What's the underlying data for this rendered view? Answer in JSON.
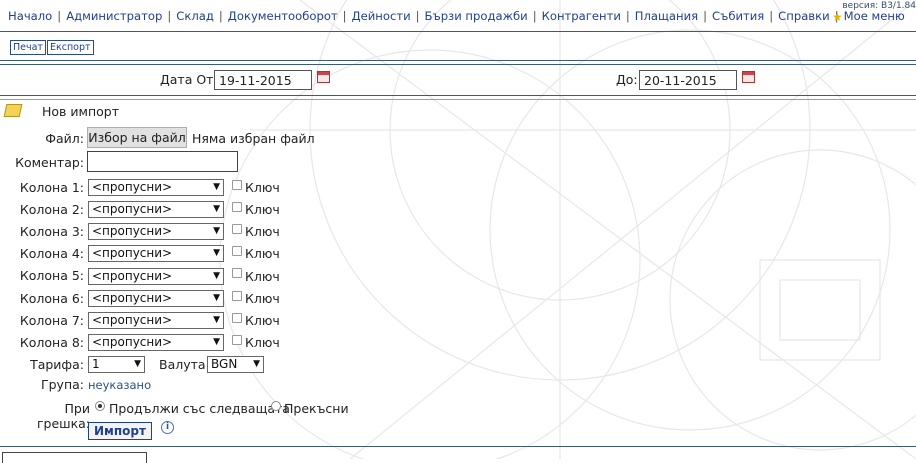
{
  "version": "версия: В3/1.84",
  "menu": [
    {
      "label": "Начало"
    },
    {
      "label": "Администратор"
    },
    {
      "label": "Склад"
    },
    {
      "label": "Документооборот"
    },
    {
      "label": "Дейности"
    },
    {
      "label": "Бързи продажби"
    },
    {
      "label": "Контрагенти"
    },
    {
      "label": "Плащания"
    },
    {
      "label": "Събития"
    },
    {
      "label": "Справки"
    },
    {
      "label": "Мое меню"
    }
  ],
  "toolbar": {
    "print_label": "Печат",
    "export_label": "Експорт"
  },
  "date_filter": {
    "from_label": "Дата От:",
    "from_value": "19-11-2015",
    "to_label": "До:",
    "to_value": "20-11-2015"
  },
  "import_form": {
    "title": "Нов импорт",
    "file_label": "Файл:",
    "file_button": "Избор на файл",
    "file_status": "Няма избран файл",
    "comment_label": "Коментар:",
    "columns": [
      {
        "label": "Колона 1:",
        "value": "<пропусни>",
        "key_label": "Ключ"
      },
      {
        "label": "Колона 2:",
        "value": "<пропусни>",
        "key_label": "Ключ"
      },
      {
        "label": "Колона 3:",
        "value": "<пропусни>",
        "key_label": "Ключ"
      },
      {
        "label": "Колона 4:",
        "value": "<пропусни>",
        "key_label": "Ключ"
      },
      {
        "label": "Колона 5:",
        "value": "<пропусни>",
        "key_label": "Ключ"
      },
      {
        "label": "Колона 6:",
        "value": "<пропусни>",
        "key_label": "Ключ"
      },
      {
        "label": "Колона 7:",
        "value": "<пропусни>",
        "key_label": "Ключ"
      },
      {
        "label": "Колона 8:",
        "value": "<пропусни>",
        "key_label": "Ключ"
      }
    ],
    "tariff_label": "Тарифа:",
    "tariff_value": "1",
    "currency_label": "Валута:",
    "currency_value": "BGN",
    "group_label": "Група:",
    "group_value": "неуказано",
    "on_error_label": "При грешка:",
    "on_error_options": [
      {
        "label": "Продължи със следващата",
        "selected": true
      },
      {
        "label": "Прекъсни",
        "selected": false
      }
    ],
    "import_button": "Импорт"
  }
}
